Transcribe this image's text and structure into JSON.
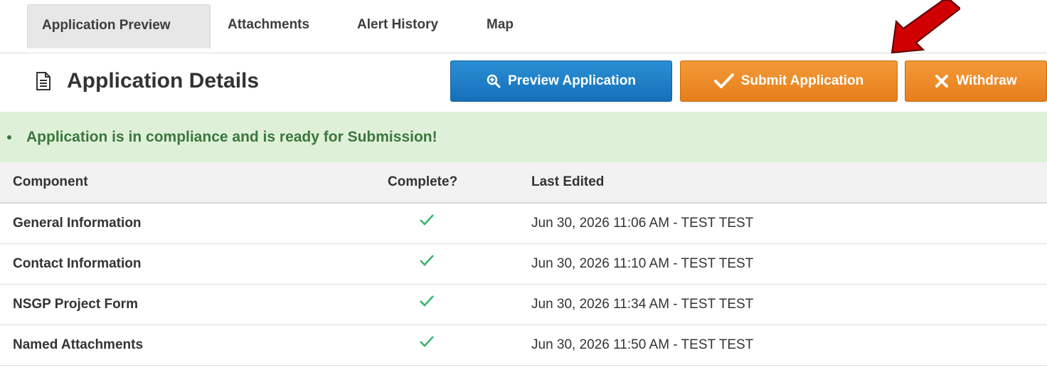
{
  "tabs": [
    {
      "label": "Application Preview"
    },
    {
      "label": "Attachments"
    },
    {
      "label": "Alert History"
    },
    {
      "label": "Map"
    }
  ],
  "header": {
    "title": "Application Details",
    "buttons": {
      "preview": "Preview Application",
      "submit": "Submit Application",
      "withdraw": "Withdraw"
    }
  },
  "alert": {
    "message": "Application is in compliance and is ready for Submission!"
  },
  "table": {
    "columns": [
      "Component",
      "Complete?",
      "Last Edited"
    ],
    "rows": [
      {
        "component": "General Information",
        "complete": true,
        "last_edited": "Jun 30, 2026 11:06 AM - TEST TEST"
      },
      {
        "component": "Contact Information",
        "complete": true,
        "last_edited": "Jun 30, 2026 11:10 AM - TEST TEST"
      },
      {
        "component": "NSGP Project Form",
        "complete": true,
        "last_edited": "Jun 30, 2026 11:34 AM - TEST TEST"
      },
      {
        "component": "Named Attachments",
        "complete": true,
        "last_edited": "Jun 30, 2026 11:50 AM - TEST TEST"
      }
    ]
  },
  "colors": {
    "primary": "#1a7ac4",
    "warning": "#ec8a26",
    "success_bg": "#dff0d8",
    "success_text": "#3c763d",
    "check": "#3cb371",
    "arrow": "#d00000"
  },
  "icons": {
    "title": "document-icon",
    "preview": "zoom-in-icon",
    "submit": "checkmark-icon",
    "withdraw": "close-icon",
    "complete": "checkmark-icon",
    "annotation": "red-arrow-icon"
  }
}
